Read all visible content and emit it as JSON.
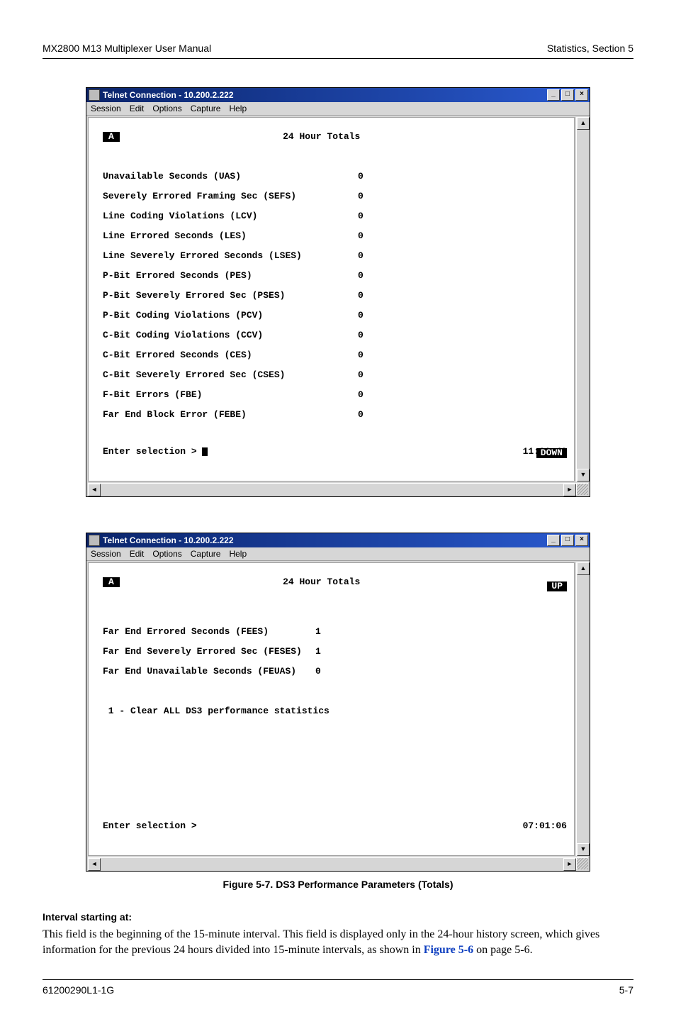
{
  "header": {
    "left": "MX2800 M13 Multiplexer User Manual",
    "right": "Statistics, Section 5"
  },
  "footer": {
    "left": "61200290L1-1G",
    "right": "5-7"
  },
  "win_common": {
    "title": "Telnet Connection - 10.200.2.222",
    "menus": [
      "Session",
      "Edit",
      "Options",
      "Capture",
      "Help"
    ],
    "ctrl_min": "_",
    "ctrl_max": "□",
    "ctrl_close": "×",
    "arrow_up": "▲",
    "arrow_down": "▼",
    "arrow_left": "◄",
    "arrow_right": "►"
  },
  "term1": {
    "chip": "A",
    "title": "24 Hour Totals",
    "rows": [
      {
        "lbl": "Unavailable Seconds (UAS)",
        "val": "0"
      },
      {
        "lbl": "Severely Errored Framing Sec (SEFS)",
        "val": "0"
      },
      {
        "lbl": "Line Coding Violations (LCV)",
        "val": "0"
      },
      {
        "lbl": "Line Errored Seconds (LES)",
        "val": "0"
      },
      {
        "lbl": "Line Severely Errored Seconds (LSES)",
        "val": "0"
      },
      {
        "lbl": "P-Bit Errored Seconds (PES)",
        "val": "0"
      },
      {
        "lbl": "P-Bit Severely Errored Sec (PSES)",
        "val": "0"
      },
      {
        "lbl": "P-Bit Coding Violations (PCV)",
        "val": "0"
      },
      {
        "lbl": "C-Bit Coding Violations (CCV)",
        "val": "0"
      },
      {
        "lbl": "C-Bit Errored Seconds (CES)",
        "val": "0"
      },
      {
        "lbl": "C-Bit Severely Errored Sec (CSES)",
        "val": "0"
      },
      {
        "lbl": "F-Bit Errors (FBE)",
        "val": "0"
      },
      {
        "lbl": "Far End Block Error (FEBE)",
        "val": "0"
      }
    ],
    "badge": "DOWN",
    "prompt": "Enter selection >",
    "clock": "11:01:43"
  },
  "term2": {
    "chip": "A",
    "title": "24 Hour Totals",
    "rows": [
      {
        "lbl": "Far End Errored Seconds (FEES)",
        "val": "1"
      },
      {
        "lbl": "Far End Severely Errored Sec (FESES)",
        "val": "1"
      },
      {
        "lbl": "Far End Unavailable Seconds (FEUAS)",
        "val": "0"
      }
    ],
    "option": " 1 - Clear ALL DS3 performance statistics",
    "badge": "UP",
    "prompt": "Enter selection >",
    "clock": "07:01:06"
  },
  "caption": "Figure 5-7.  DS3 Performance Parameters (Totals)",
  "section": {
    "heading": "Interval starting at:",
    "body_a": "This field is the beginning of the 15-minute interval. This field is displayed only in the 24-hour history screen, which gives information for the previous 24 hours divided into 15-minute intervals, as shown in ",
    "link": "Figure 5-6",
    "body_b": " on page 5-6."
  }
}
